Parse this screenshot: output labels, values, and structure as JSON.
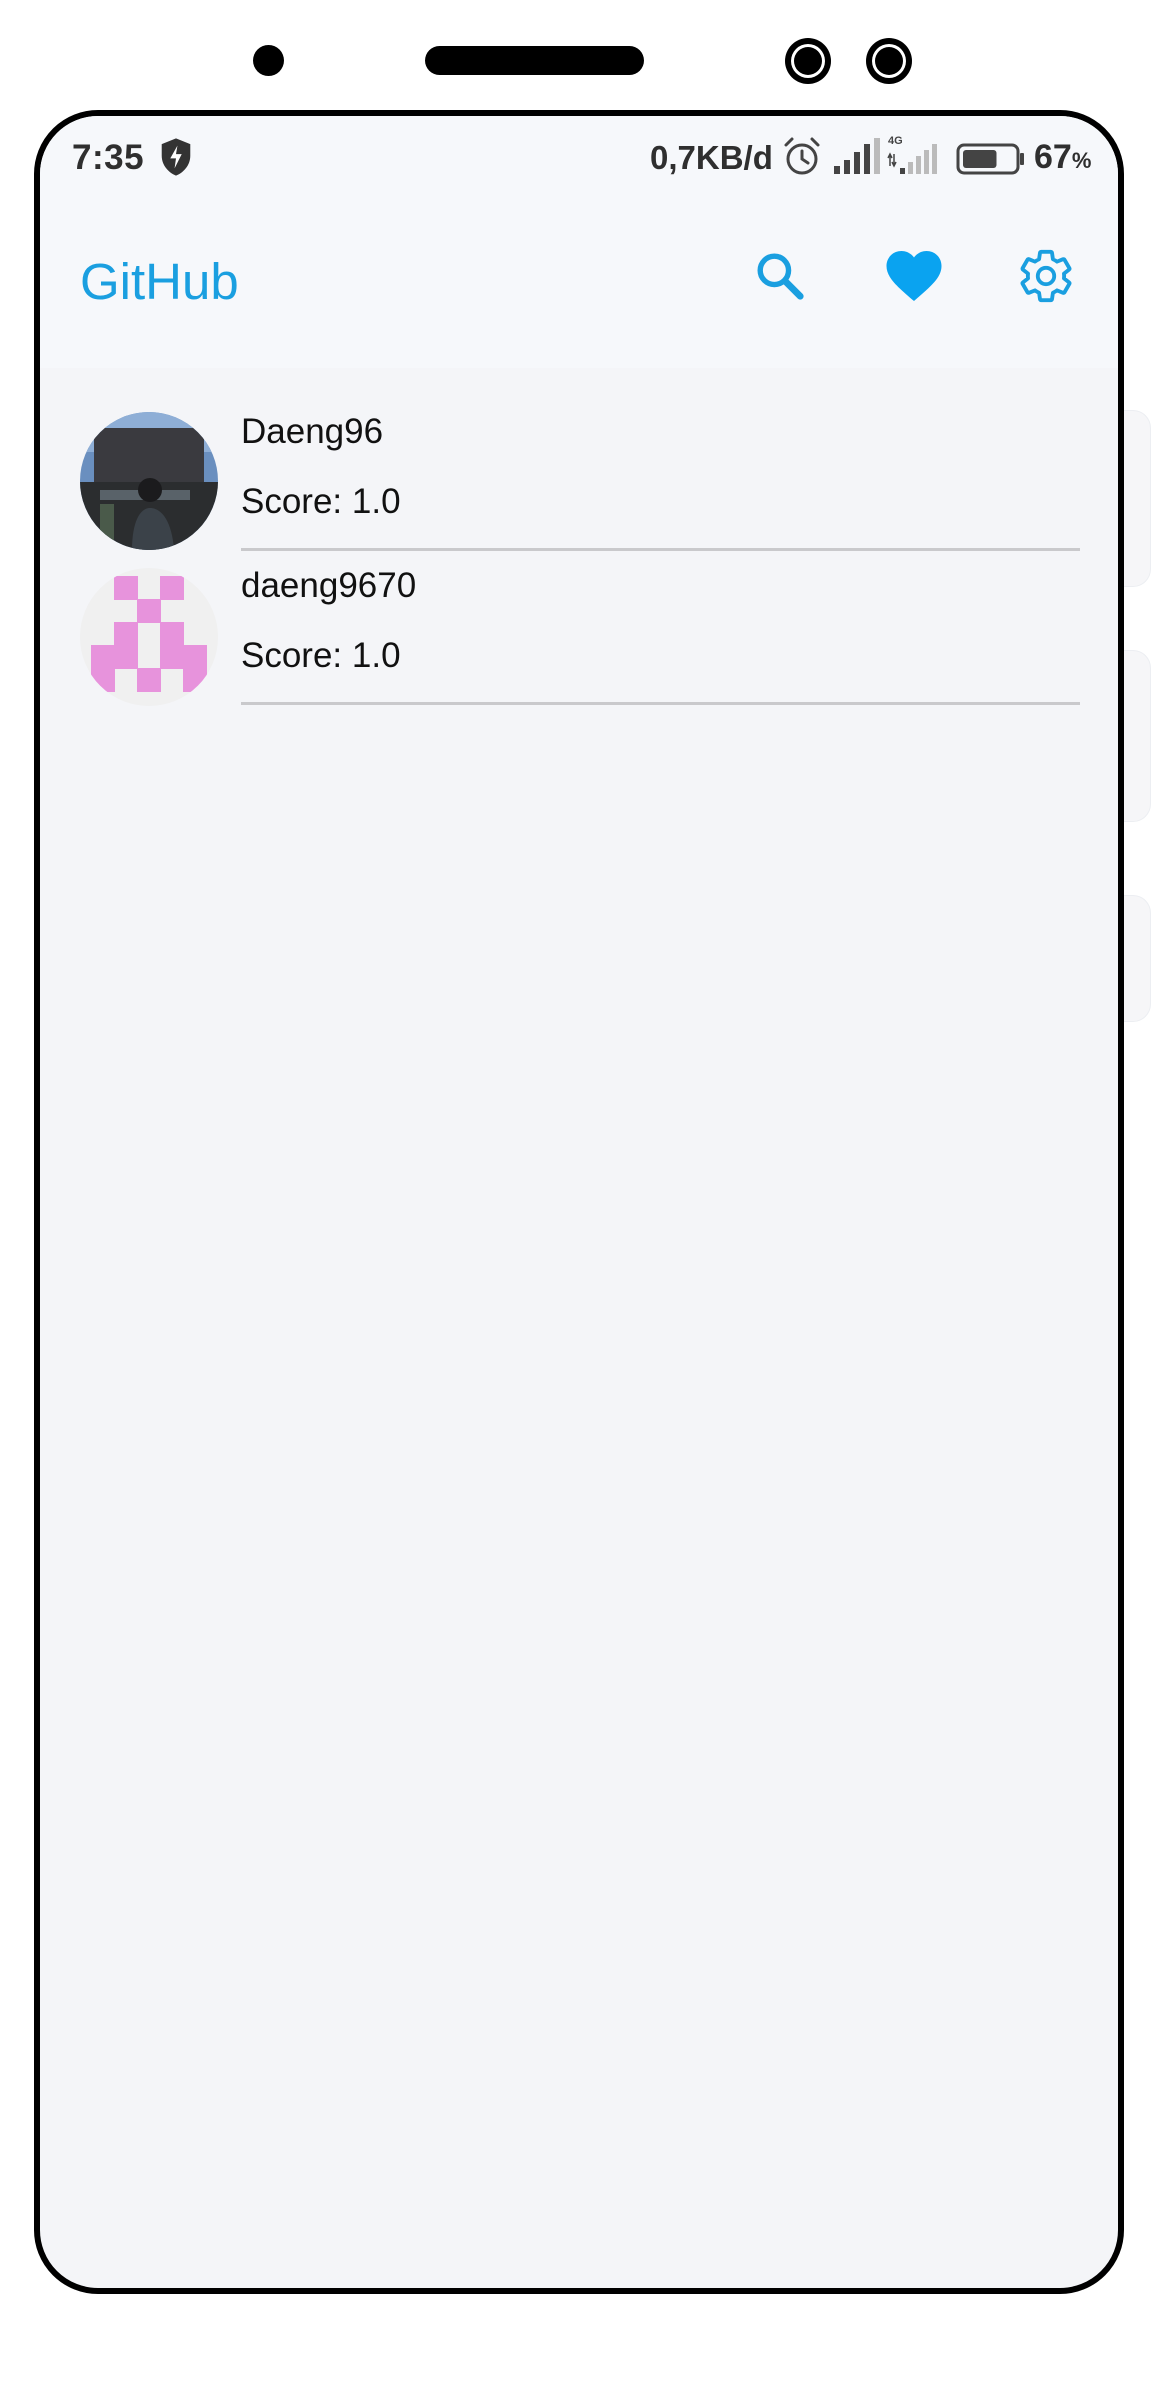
{
  "status_bar": {
    "time": "7:35",
    "net_speed": "0,7KB/d",
    "network_type": "4G",
    "battery_value": "67",
    "battery_unit": "%",
    "battery_level_pct": 67
  },
  "app_bar": {
    "title": "GitHub",
    "actions": [
      "search-icon",
      "heart-icon",
      "gear-icon"
    ],
    "accent_color": "#1a9fe0"
  },
  "users": [
    {
      "login": "Daeng96",
      "score": "Score: 1.0",
      "avatar": "photo"
    },
    {
      "login": "daeng9670",
      "score": "Score: 1.0",
      "avatar": "identicon",
      "identicon_color": "#e793dc"
    }
  ]
}
